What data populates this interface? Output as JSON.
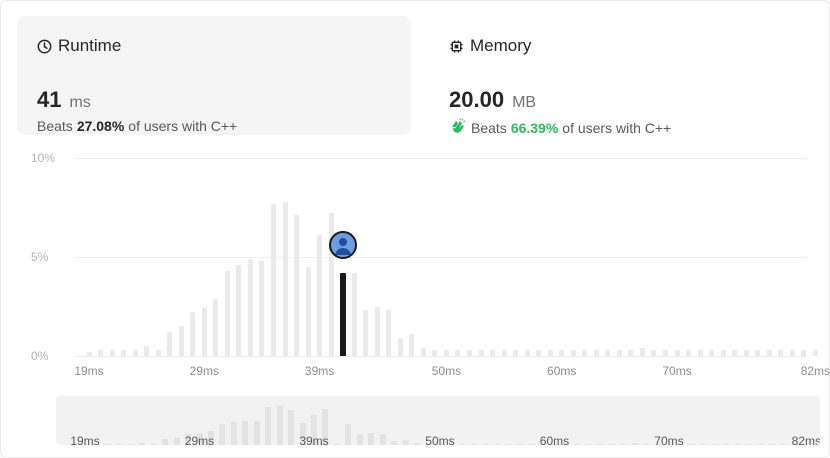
{
  "runtime": {
    "title": "Runtime",
    "icon": "clock-icon",
    "value": "41",
    "unit": "ms",
    "beats_prefix": "Beats",
    "beats_pct": "27.08%",
    "beats_suffix": "of users with C++"
  },
  "memory": {
    "title": "Memory",
    "icon": "chip-icon",
    "value": "20.00",
    "unit": "MB",
    "beats_icon": "clapping-hands-icon",
    "beats_prefix": "Beats",
    "beats_pct": "66.39%",
    "beats_suffix": "of users with C++",
    "accent": "#2cbb5d"
  },
  "chart_data": {
    "type": "bar",
    "ylim": [
      0,
      10
    ],
    "y_ticks": [
      "0%",
      "5%",
      "10%"
    ],
    "x_tick_labels": [
      "19ms",
      "29ms",
      "39ms",
      "50ms",
      "60ms",
      "70ms",
      "82ms"
    ],
    "x_tick_values": [
      19,
      29,
      39,
      50,
      60,
      70,
      82
    ],
    "highlight_x": 41,
    "values": [
      0.2,
      0.3,
      0.3,
      0.3,
      0.3,
      0.5,
      0.3,
      1.2,
      1.5,
      2.2,
      2.4,
      2.9,
      4.3,
      4.6,
      4.9,
      4.8,
      7.7,
      7.8,
      7.1,
      4.5,
      6.1,
      7.2,
      0.0,
      4.2,
      2.3,
      2.5,
      2.3,
      0.9,
      1.1,
      0.4,
      0.3,
      0.3,
      0.3,
      0.3,
      0.3,
      0.3,
      0.3,
      0.3,
      0.3,
      0.3,
      0.3,
      0.3,
      0.3,
      0.3,
      0.3,
      0.3,
      0.3,
      0.3,
      0.4,
      0.3,
      0.3,
      0.3,
      0.3,
      0.3,
      0.3,
      0.3,
      0.3,
      0.3,
      0.3,
      0.3,
      0.3,
      0.3,
      0.3,
      0.3
    ]
  }
}
